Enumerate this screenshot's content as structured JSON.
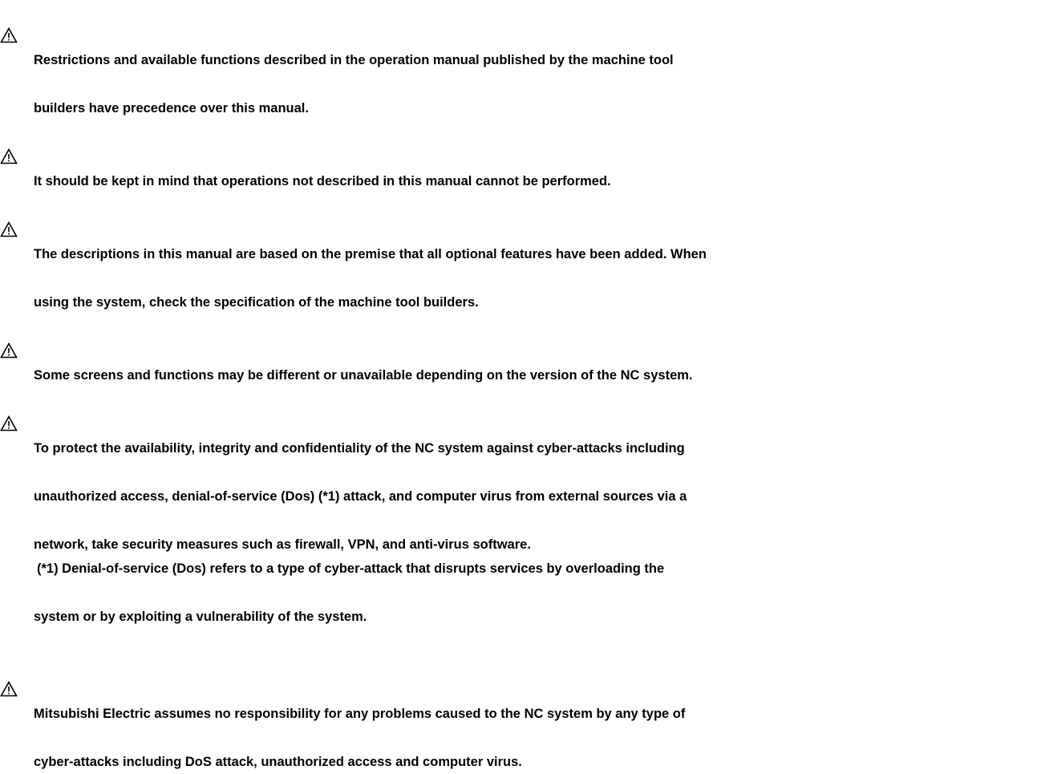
{
  "icons": {
    "warning": "warning-triangle-icon"
  },
  "notes": [
    {
      "line1": "Restrictions and available functions described in the operation manual published by the machine tool",
      "line2": "builders have precedence over this manual."
    },
    {
      "line1": "It should be kept in mind that operations not described in this manual cannot be performed."
    },
    {
      "line1": "The descriptions in this manual are based on the premise that all optional features have been added. When",
      "line2": "using the system, check the specification of the machine tool builders."
    },
    {
      "line1": "Some screens and functions may be different or unavailable depending on the version of the NC system."
    },
    {
      "line1": "To protect the availability, integrity and confidentiality of the NC system against cyber-attacks including",
      "line2": "unauthorized access, denial-of-service (Dos) (*1) attack, and computer virus from external sources via a",
      "line3": "network, take security measures such as firewall, VPN, and anti-virus software.",
      "footnote1": "(*1) Denial-of-service (Dos) refers to a type of cyber-attack that disrupts services by overloading the",
      "footnote2": "system or by exploiting a vulnerability of the system."
    },
    {
      "line1": "Mitsubishi Electric assumes no responsibility for any problems caused to the NC system by any type of",
      "line2": "cyber-attacks including DoS attack, unauthorized access and computer virus."
    }
  ]
}
